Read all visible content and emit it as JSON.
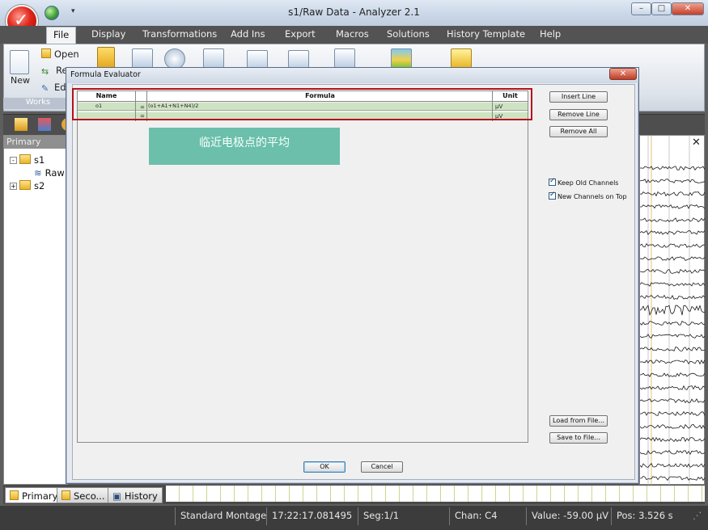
{
  "window": {
    "title": "s1/Raw Data - Analyzer 2.1"
  },
  "ribbon": {
    "tabs": [
      "File",
      "Display",
      "Transformations",
      "Add Ins",
      "Export",
      "Macros",
      "Solutions",
      "History Template",
      "Help"
    ],
    "active_tab": "File",
    "work_group_label": "Works",
    "new_label": "New",
    "open_label": "Open",
    "re_label": "Re",
    "ed_label": "Ed"
  },
  "left_panel": {
    "title": "Primary",
    "tree": [
      {
        "label": "s1",
        "expander": "-"
      },
      {
        "label": "Raw"
      },
      {
        "label": "s2",
        "expander": "+"
      }
    ]
  },
  "bottom_tabs": [
    "Primary",
    "Seco...",
    "History"
  ],
  "status": {
    "montage": "Standard Montage",
    "time": "17:22:17.081495",
    "seg": "Seg:1/1",
    "chan": "Chan:  C4",
    "value": "Value: -59.00 µV",
    "pos": "Pos:  3.526 s"
  },
  "dialog": {
    "title": "Formula Evaluator",
    "columns": [
      "Name",
      "Formula",
      "Unit"
    ],
    "rows": [
      {
        "name": "o1",
        "eq": "=",
        "formula": "(o1+A1+N1+N4)/2",
        "unit": "µV"
      },
      {
        "name": "",
        "eq": "=",
        "formula": "",
        "unit": "µV"
      }
    ],
    "buttons": {
      "insert_line": "Insert Line",
      "remove_line": "Remove Line",
      "remove_all": "Remove All",
      "load_from_file": "Load from File...",
      "save_to_file": "Save to File...",
      "ok": "OK",
      "cancel": "Cancel"
    },
    "options": {
      "keep_old_channels": "Keep Old Channels",
      "new_channels_on_top": "New Channels on Top"
    }
  },
  "annotation": {
    "text": "临近电极点的平均"
  },
  "colors": {
    "grid_row": "#cfe3c3",
    "highlight_box": "#b5121b",
    "annotation_bg": "#6bbfab"
  }
}
